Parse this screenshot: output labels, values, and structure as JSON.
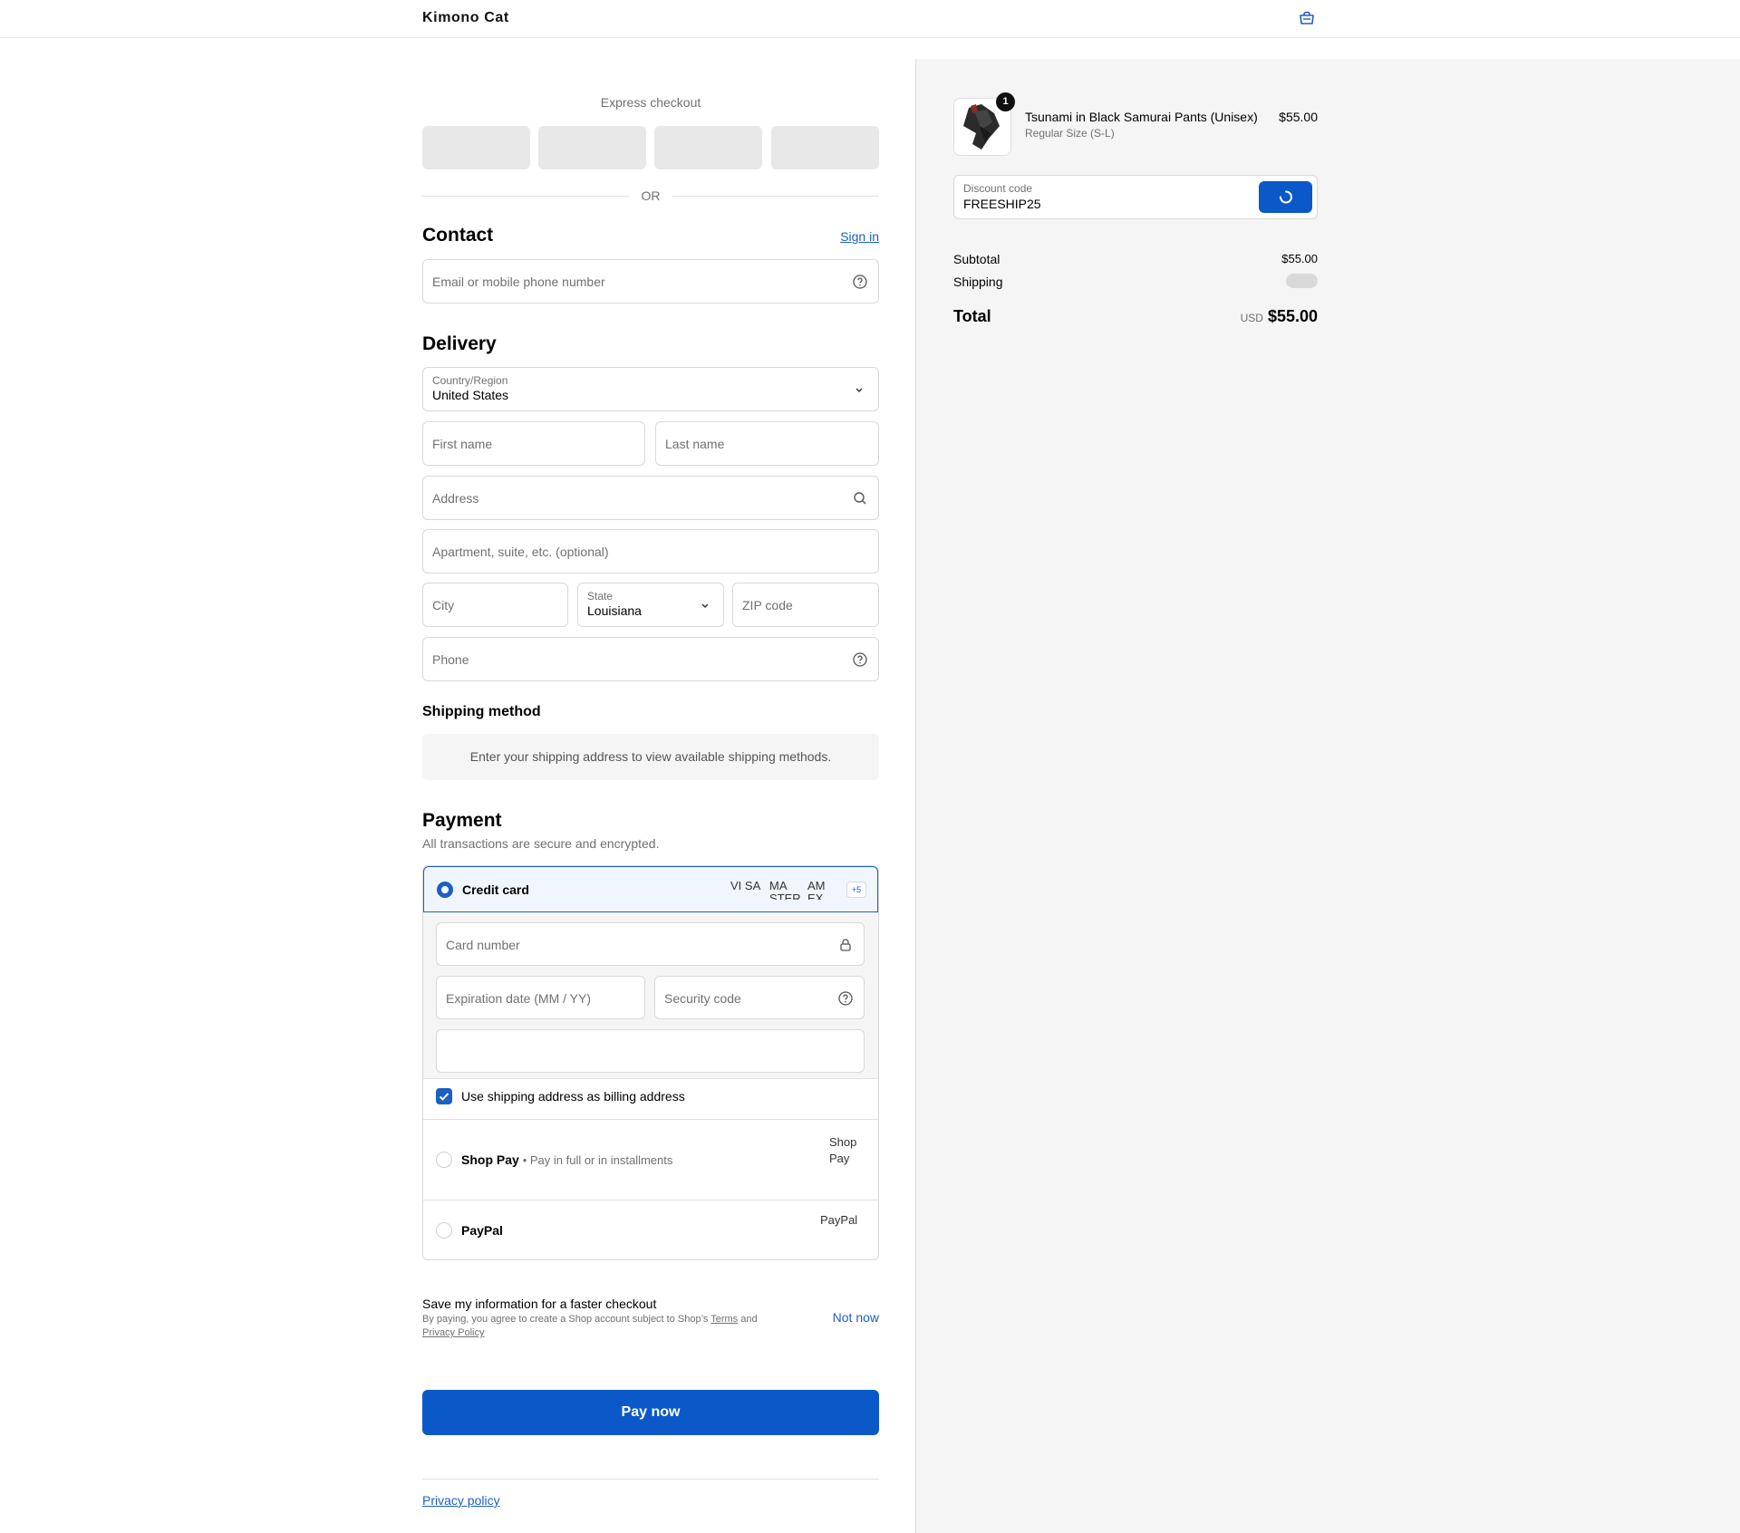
{
  "store": {
    "name": "Kimono Cat"
  },
  "express": {
    "title": "Express checkout",
    "or": "OR"
  },
  "contact": {
    "title": "Contact",
    "sign_in": "Sign in",
    "email_placeholder": "Email or mobile phone number"
  },
  "delivery": {
    "title": "Delivery",
    "country_label": "Country/Region",
    "country_value": "United States",
    "first_name_placeholder": "First name",
    "last_name_placeholder": "Last name",
    "address_placeholder": "Address",
    "apartment_placeholder": "Apartment, suite, etc. (optional)",
    "city_placeholder": "City",
    "state_label": "State",
    "state_value": "Louisiana",
    "zip_placeholder": "ZIP code",
    "phone_placeholder": "Phone"
  },
  "shipping_method": {
    "title": "Shipping method",
    "message": "Enter your shipping address to view available shipping methods."
  },
  "payment": {
    "title": "Payment",
    "subtitle": "All transactions are secure and encrypted.",
    "credit_card_label": "Credit card",
    "card_logos": [
      "VISA",
      "MASTER",
      "AMEX"
    ],
    "card_logo_alts": [
      "VI SA",
      "MA STER",
      "AM EX"
    ],
    "more_cards": "+5",
    "card_number_placeholder": "Card number",
    "expiration_placeholder": "Expiration date (MM / YY)",
    "security_placeholder": "Security code",
    "billing_checkbox_label": "Use shipping address as billing address",
    "billing_checked": true,
    "shop_pay_label": "Shop Pay",
    "shop_pay_sub": "Pay in full or in installments",
    "shop_pay_alt": "Shop Pay",
    "paypal_label": "PayPal",
    "paypal_alt": "PayPal",
    "selected_method": "Credit card"
  },
  "save_info": {
    "title": "Save my information for a faster checkout",
    "fine_prefix": "By paying, you agree to create a Shop account subject to Shop’s ",
    "terms": "Terms",
    "and": " and",
    "privacy": "Privacy Policy",
    "not_now": "Not now"
  },
  "pay_button": "Pay now",
  "footer": {
    "privacy_policy": "Privacy policy"
  },
  "summary": {
    "product_name": "Tsunami in Black Samurai Pants (Unisex)",
    "variant": "Regular Size (S-L)",
    "quantity": "1",
    "price": "$55.00",
    "discount_label": "Discount code",
    "discount_value": "FREESHIP25",
    "subtotal_label": "Subtotal",
    "subtotal_value": "$55.00",
    "shipping_label": "Shipping",
    "total_label": "Total",
    "currency": "USD",
    "total_value": "$55.00"
  },
  "colors": {
    "accent": "#0b59c8",
    "link": "#1c5fc5",
    "summary_bg": "#f5f5f5",
    "border": "#d9d9d9"
  }
}
